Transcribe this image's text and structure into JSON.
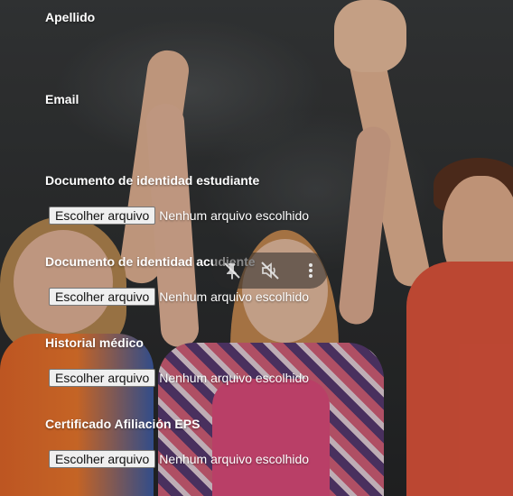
{
  "form": {
    "fields": [
      {
        "label": "Apellido"
      },
      {
        "label": "Email"
      },
      {
        "label": "Documento de identidad estudiante",
        "button": "Escolher arquivo",
        "status": "Nenhum arquivo escolhido"
      },
      {
        "label": "Documento de identidad acudiente",
        "button": "Escolher arquivo",
        "status": "Nenhum arquivo escolhido"
      },
      {
        "label": "Historial médico",
        "button": "Escolher arquivo",
        "status": "Nenhum arquivo escolhido"
      },
      {
        "label": "Certificado Afiliación EPS",
        "button": "Escolher arquivo",
        "status": "Nenhum arquivo escolhido"
      }
    ]
  },
  "video_overlay": {
    "icons": [
      "pin-off-icon",
      "volume-off-icon",
      "more-vert-icon"
    ]
  },
  "colors": {
    "label_text": "#ffffff",
    "button_bg": "#efefef",
    "overlay_bg": "rgba(40,40,40,0.55)"
  }
}
